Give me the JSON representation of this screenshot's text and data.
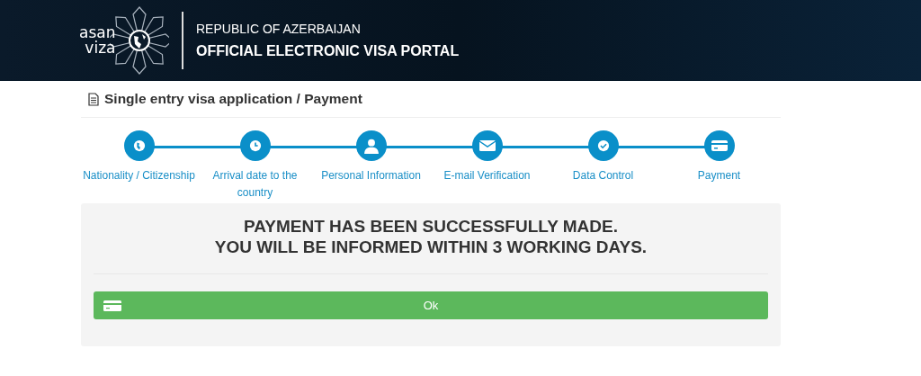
{
  "header": {
    "logo_top": "asan",
    "logo_bottom": "viza",
    "subtitle": "REPUBLIC OF AZERBAIJAN",
    "title": "OFFICIAL ELECTRONIC VISA PORTAL"
  },
  "page_title": "Single entry visa application / Payment",
  "steps": [
    {
      "kind": "globe",
      "label": "Nationality / Citizenship"
    },
    {
      "kind": "clock",
      "label": "Arrival date to the country"
    },
    {
      "kind": "user",
      "label": "Personal Information"
    },
    {
      "kind": "mail",
      "label": "E-mail Verification"
    },
    {
      "kind": "check",
      "label": "Data Control"
    },
    {
      "kind": "card",
      "label": "Payment"
    }
  ],
  "message": [
    "PAYMENT HAS BEEN SUCCESSFULLY MADE.",
    "YOU WILL BE INFORMED WITHIN 3 WORKING DAYS."
  ],
  "ok_button": "Ok"
}
